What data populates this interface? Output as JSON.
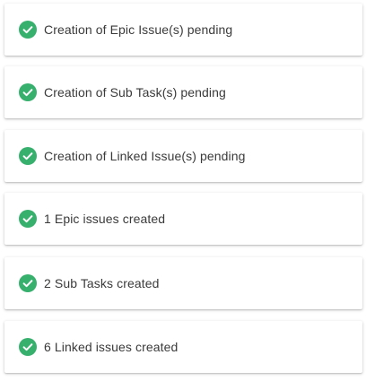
{
  "accent_color": "#37b06e",
  "status_items": [
    {
      "label": "Creation of Epic Issue(s) pending",
      "icon": "check-circle-icon"
    },
    {
      "label": "Creation of Sub Task(s) pending",
      "icon": "check-circle-icon"
    },
    {
      "label": "Creation of Linked Issue(s) pending",
      "icon": "check-circle-icon"
    },
    {
      "label": "1 Epic issues created",
      "icon": "check-circle-icon"
    },
    {
      "label": "2 Sub Tasks created",
      "icon": "check-circle-icon"
    },
    {
      "label": "6 Linked issues created",
      "icon": "check-circle-icon"
    }
  ]
}
